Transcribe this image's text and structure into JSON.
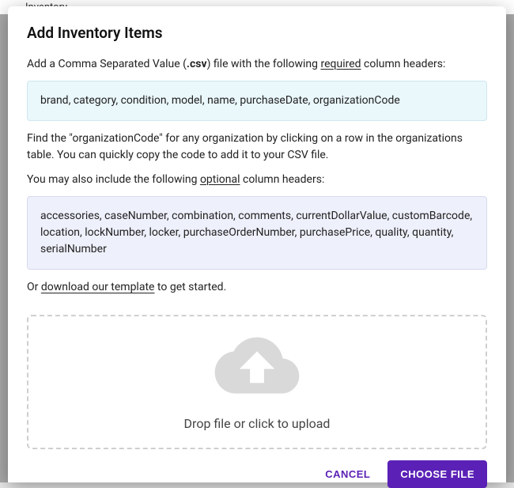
{
  "backdrop": {
    "nav_item": "Inventory"
  },
  "modal": {
    "title": "Add Inventory Items",
    "intro_prefix": "Add a Comma Separated Value (",
    "intro_ext": ".csv",
    "intro_mid": ") file with the following ",
    "intro_required_word": "required",
    "intro_suffix": " column headers:",
    "required_headers": "brand, category, condition, model, name, purchaseDate, organizationCode",
    "org_help": "Find the \"organizationCode\" for any organization by clicking on a row in the organizations table. You can quickly copy the code to add it to your CSV file.",
    "optional_intro_prefix": "You may also include the following ",
    "optional_word": "optional",
    "optional_intro_suffix": " column headers:",
    "optional_headers": "accessories, caseNumber, combination, comments, currentDollarValue, customBarcode, location, lockNumber, locker, purchaseOrderNumber, purchasePrice, quality, quantity, serialNumber",
    "template_prefix": "Or ",
    "template_link": "download our template",
    "template_suffix": " to get started.",
    "dropzone_label": "Drop file or click to upload"
  },
  "footer": {
    "cancel": "CANCEL",
    "choose": "CHOOSE FILE"
  },
  "colors": {
    "primary": "#5b21b6",
    "required_bg": "#eaf7fb",
    "optional_bg": "#eef0fb"
  }
}
